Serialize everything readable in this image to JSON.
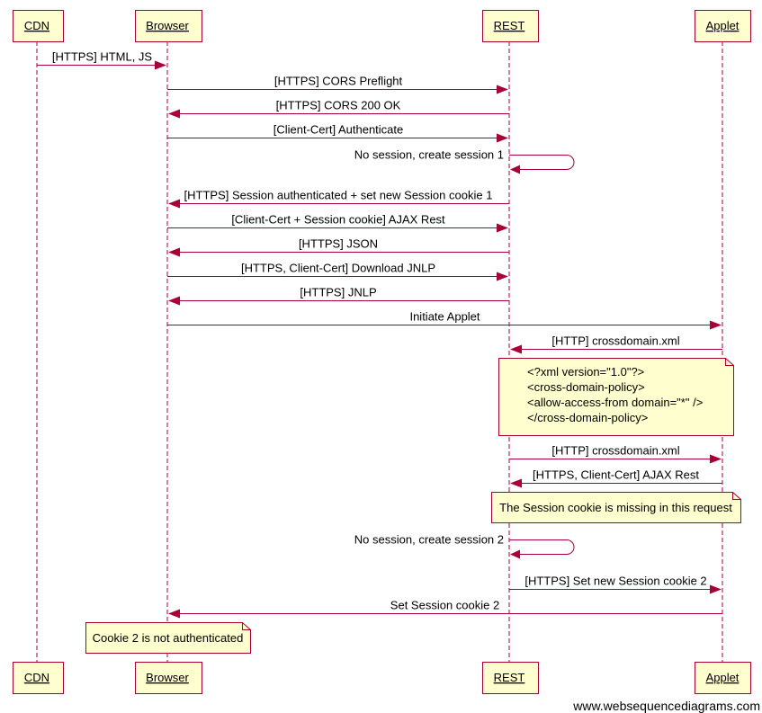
{
  "colors": {
    "line": "#a80036",
    "box_fill": "#fefece",
    "text": "#000000"
  },
  "participants": [
    {
      "id": "cdn",
      "label": "CDN"
    },
    {
      "id": "browser",
      "label": "Browser"
    },
    {
      "id": "rest",
      "label": "REST"
    },
    {
      "id": "applet",
      "label": "Applet"
    }
  ],
  "messages": [
    {
      "from": "cdn",
      "to": "browser",
      "label": "[HTTPS] HTML, JS"
    },
    {
      "from": "browser",
      "to": "rest",
      "label": "[HTTPS] CORS Preflight"
    },
    {
      "from": "rest",
      "to": "browser",
      "label": "[HTTPS] CORS 200 OK"
    },
    {
      "from": "browser",
      "to": "rest",
      "label": "[Client-Cert] Authenticate"
    },
    {
      "from": "rest",
      "to": "rest",
      "label": "No session, create session 1"
    },
    {
      "from": "rest",
      "to": "browser",
      "label": "[HTTPS] Session authenticated + set new Session cookie 1"
    },
    {
      "from": "browser",
      "to": "rest",
      "label": "[Client-Cert + Session cookie] AJAX Rest"
    },
    {
      "from": "rest",
      "to": "browser",
      "label": "[HTTPS] JSON"
    },
    {
      "from": "browser",
      "to": "rest",
      "label": "[HTTPS, Client-Cert] Download JNLP"
    },
    {
      "from": "rest",
      "to": "browser",
      "label": "[HTTPS] JNLP"
    },
    {
      "from": "browser",
      "to": "applet",
      "label": "Initiate Applet"
    },
    {
      "from": "applet",
      "to": "rest",
      "label": "[HTTP] crossdomain.xml"
    },
    {
      "from": "rest",
      "to": "applet",
      "label": "[HTTP] crossdomain.xml"
    },
    {
      "from": "applet",
      "to": "rest",
      "label": "[HTTPS, Client-Cert] AJAX Rest"
    },
    {
      "from": "rest",
      "to": "rest",
      "label": "No session, create session 2"
    },
    {
      "from": "rest",
      "to": "applet",
      "label": "[HTTPS] Set new Session cookie 2"
    },
    {
      "from": "applet",
      "to": "browser",
      "label": "Set Session cookie 2"
    }
  ],
  "notes": [
    {
      "lines": [
        "<?xml version=\"1.0\"?>",
        "<cross-domain-policy>",
        "<allow-access-from domain=\"*\" />",
        "</cross-domain-policy>"
      ]
    },
    {
      "lines": [
        "The Session cookie is missing in this request"
      ]
    },
    {
      "lines": [
        "Cookie 2 is not authenticated"
      ]
    }
  ],
  "footer": "www.websequencediagrams.com"
}
